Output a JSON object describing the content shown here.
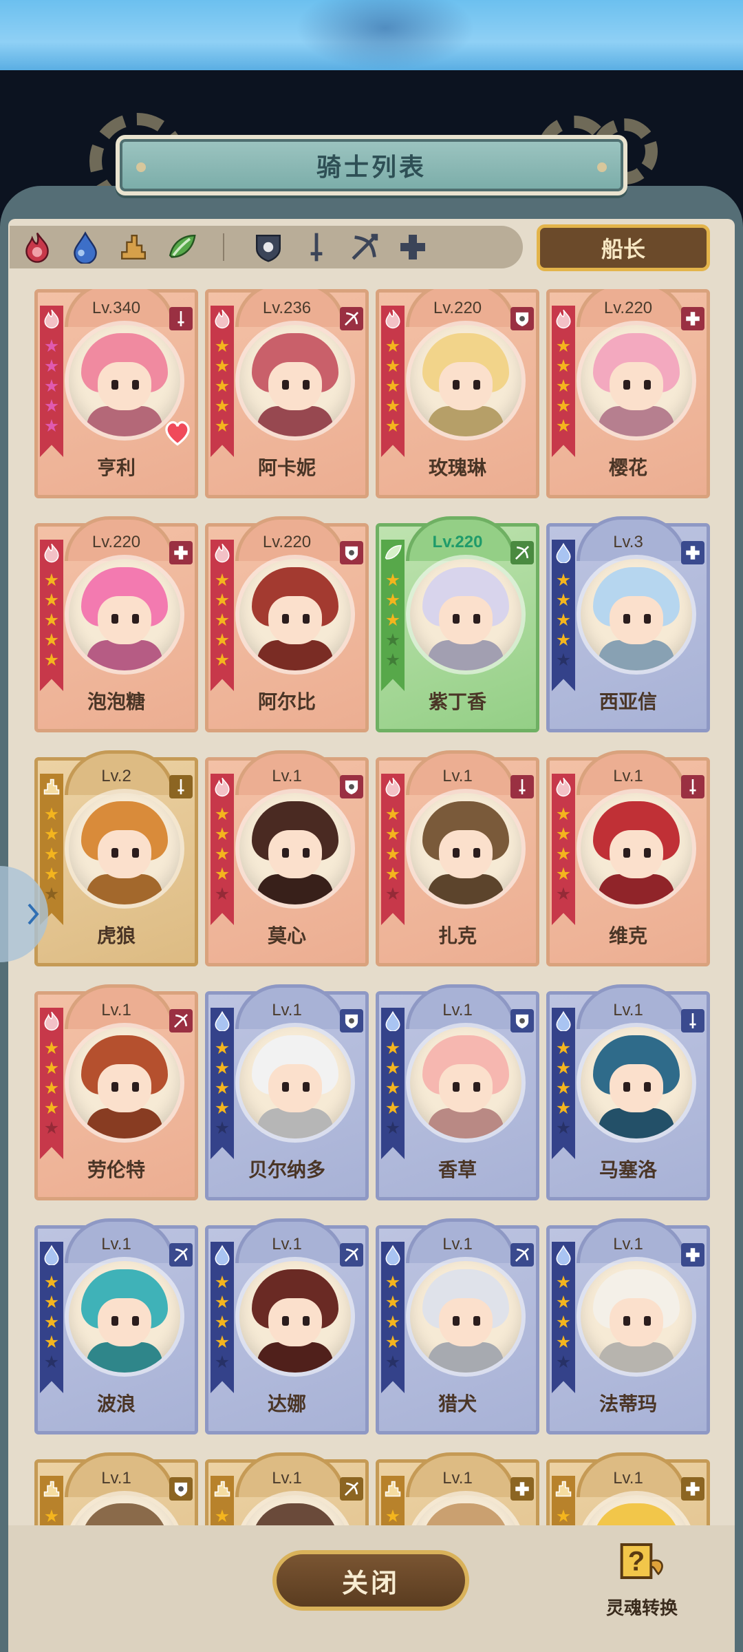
{
  "header": {
    "title": "骑士列表"
  },
  "filters": {
    "elements": [
      {
        "name": "fire-icon",
        "color": "#c7384a"
      },
      {
        "name": "water-icon",
        "color": "#3d6fc8"
      },
      {
        "name": "earth-icon",
        "color": "#b8822b"
      },
      {
        "name": "wind-icon",
        "color": "#57a84a"
      }
    ],
    "classes": [
      "shield-class-icon",
      "sword-class-icon",
      "bow-class-icon",
      "plus-class-icon"
    ],
    "captain_label": "船长"
  },
  "knights": [
    {
      "name": "亨利",
      "level": "Lv.340",
      "element": "fire",
      "class": "sword",
      "stars": 5,
      "star_color": "#e05ab0",
      "favorite": true
    },
    {
      "name": "阿卡妮",
      "level": "Lv.236",
      "element": "fire",
      "class": "bow",
      "stars": 5,
      "star_color": "#f4b51e"
    },
    {
      "name": "玫瑰琳",
      "level": "Lv.220",
      "element": "fire",
      "class": "shield",
      "stars": 5,
      "star_color": "#f4b51e"
    },
    {
      "name": "樱花",
      "level": "Lv.220",
      "element": "fire",
      "class": "plus",
      "stars": 5,
      "star_color": "#f4b51e"
    },
    {
      "name": "泡泡糖",
      "level": "Lv.220",
      "element": "fire",
      "class": "plus",
      "stars": 5,
      "star_color": "#f4b51e"
    },
    {
      "name": "阿尔比",
      "level": "Lv.220",
      "element": "fire",
      "class": "shield",
      "stars": 5,
      "star_color": "#f4b51e"
    },
    {
      "name": "紫丁香",
      "level": "Lv.220",
      "element": "wind",
      "class": "bow",
      "stars": 3,
      "star_color": "#f4b51e"
    },
    {
      "name": "西亚信",
      "level": "Lv.3",
      "element": "water",
      "class": "plus",
      "stars": 4,
      "star_color": "#f4b51e"
    },
    {
      "name": "虎狼",
      "level": "Lv.2",
      "element": "earth",
      "class": "sword",
      "stars": 4,
      "star_color": "#f4b51e"
    },
    {
      "name": "莫心",
      "level": "Lv.1",
      "element": "fire",
      "class": "shield",
      "stars": 4,
      "star_color": "#f4b51e"
    },
    {
      "name": "扎克",
      "level": "Lv.1",
      "element": "fire",
      "class": "sword",
      "stars": 4,
      "star_color": "#f4b51e"
    },
    {
      "name": "维克",
      "level": "Lv.1",
      "element": "fire",
      "class": "sword",
      "stars": 4,
      "star_color": "#f4b51e"
    },
    {
      "name": "劳伦特",
      "level": "Lv.1",
      "element": "fire",
      "class": "bow",
      "stars": 4,
      "star_color": "#f4b51e"
    },
    {
      "name": "贝尔纳多",
      "level": "Lv.1",
      "element": "water",
      "class": "shield",
      "stars": 4,
      "star_color": "#f4b51e"
    },
    {
      "name": "香草",
      "level": "Lv.1",
      "element": "water",
      "class": "shield",
      "stars": 4,
      "star_color": "#f4b51e"
    },
    {
      "name": "马塞洛",
      "level": "Lv.1",
      "element": "water",
      "class": "sword",
      "stars": 4,
      "star_color": "#f4b51e"
    },
    {
      "name": "波浪",
      "level": "Lv.1",
      "element": "water",
      "class": "bow",
      "stars": 4,
      "star_color": "#f4b51e"
    },
    {
      "name": "达娜",
      "level": "Lv.1",
      "element": "water",
      "class": "bow",
      "stars": 4,
      "star_color": "#f4b51e"
    },
    {
      "name": "猎犬",
      "level": "Lv.1",
      "element": "water",
      "class": "bow",
      "stars": 4,
      "star_color": "#f4b51e"
    },
    {
      "name": "法蒂玛",
      "level": "Lv.1",
      "element": "water",
      "class": "plus",
      "stars": 4,
      "star_color": "#f4b51e"
    },
    {
      "name": "",
      "level": "Lv.1",
      "element": "earth",
      "class": "shield",
      "stars": 4,
      "star_color": "#f4b51e"
    },
    {
      "name": "",
      "level": "Lv.1",
      "element": "earth",
      "class": "bow",
      "stars": 4,
      "star_color": "#f4b51e"
    },
    {
      "name": "",
      "level": "Lv.1",
      "element": "earth",
      "class": "plus",
      "stars": 4,
      "star_color": "#f4b51e"
    },
    {
      "name": "",
      "level": "Lv.1",
      "element": "earth",
      "class": "plus",
      "stars": 4,
      "star_color": "#f4b51e"
    }
  ],
  "footer": {
    "close_label": "关闭",
    "soul_label": "灵魂转换"
  }
}
